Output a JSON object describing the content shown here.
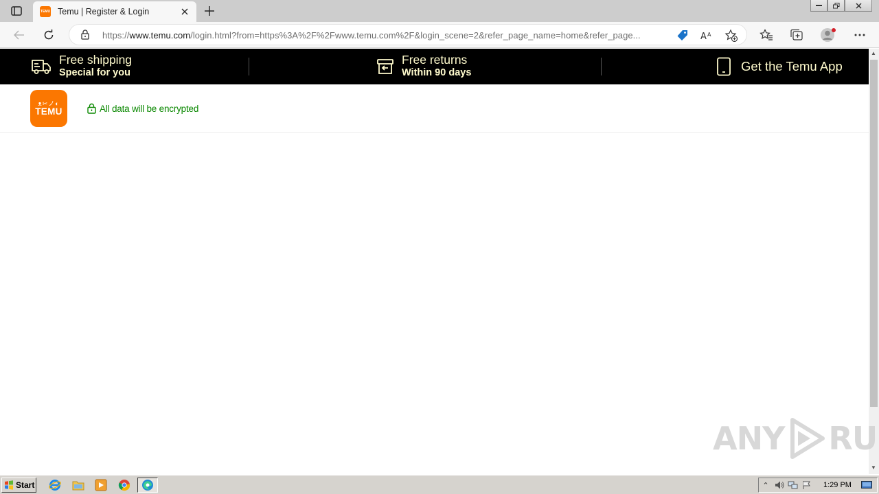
{
  "browser": {
    "tab": {
      "title": "Temu | Register & Login",
      "favicon_text": "TEMU"
    },
    "url": {
      "prefix": "https://",
      "host": "www.temu.com",
      "rest": "/login.html?from=https%3A%2F%2Fwww.temu.com%2F&login_scene=2&refer_page_name=home&refer_page..."
    },
    "icons": [
      "back-icon",
      "refresh-icon",
      "lock-icon",
      "tag-icon",
      "read-aloud-icon",
      "add-favorite-icon",
      "favorites-icon",
      "collections-icon",
      "profile-icon",
      "more-icon"
    ]
  },
  "promo": {
    "shipping": {
      "title": "Free shipping",
      "subtitle": "Special for you"
    },
    "returns": {
      "title": "Free returns",
      "subtitle": "Within 90 days"
    },
    "app": {
      "label": "Get the Temu App"
    }
  },
  "header": {
    "logo": {
      "glyphs": "ᴥ✂ノ◐",
      "word": "TEMU"
    },
    "secure_text": "All data will be encrypted"
  },
  "watermark": {
    "left": "ANY",
    "right": "RUN"
  },
  "taskbar": {
    "start_label": "Start",
    "clock": "1:29 PM"
  },
  "colors": {
    "brand": "#fb7701",
    "promo_text": "#fffbcd",
    "secure_green": "#0a8800"
  }
}
